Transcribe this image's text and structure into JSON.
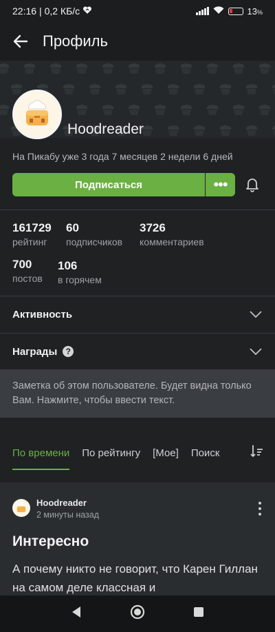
{
  "status_bar": {
    "time": "22:16",
    "speed": "| 0,2 КБ/с",
    "battery": "13",
    "battery_unit": "%"
  },
  "app_bar": {
    "title": "Профиль"
  },
  "profile": {
    "username": "Hoodreader",
    "since": "На Пикабу уже 3 года 7 месяцев 2 недели 6 дней",
    "subscribe_label": "Подписаться",
    "more_label": "•••"
  },
  "stats": [
    {
      "value": "161729",
      "label": "рейтинг"
    },
    {
      "value": "60",
      "label": "подписчиков"
    },
    {
      "value": "3726",
      "label": "комментариев"
    },
    {
      "value": "700",
      "label": "постов"
    },
    {
      "value": "106",
      "label": "в горячем"
    }
  ],
  "sections": {
    "activity": "Активность",
    "awards": "Награды",
    "help": "?"
  },
  "note": {
    "text": "Заметка об этом пользователе. Будет видна только Вам. Нажмите, чтобы ввести текст."
  },
  "tabs": [
    {
      "label": "По времени",
      "active": true
    },
    {
      "label": "По рейтингу",
      "active": false
    },
    {
      "label": "[Мое]",
      "active": false
    },
    {
      "label": "Поиск",
      "active": false
    }
  ],
  "post": {
    "author": "Hoodreader",
    "time": "2 минуты назад",
    "title": "Интересно",
    "body": "А почему никто не говорит, что Карен Гиллан на самом деле классная и"
  },
  "colors": {
    "accent": "#6bb042",
    "background": "#1f2123",
    "note_bg": "#3a3d41"
  },
  "icons": {
    "back": "arrow-left-icon",
    "bell": "bell-icon",
    "chevron": "chevron-down-icon",
    "sort": "sort-icon",
    "menu": "kebab-menu-icon"
  }
}
